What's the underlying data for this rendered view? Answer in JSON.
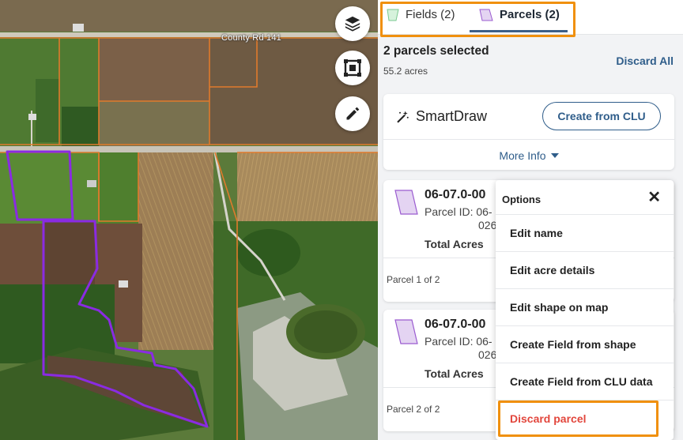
{
  "map": {
    "road_label": "County Rd 141",
    "controls": [
      {
        "name": "layers-button",
        "icon": "layers-icon"
      },
      {
        "name": "select-area-button",
        "icon": "select-frame-icon"
      },
      {
        "name": "draw-button",
        "icon": "pencil-icon"
      }
    ],
    "colors": {
      "parcel_outline": "#8a2be2",
      "field_boundary": "#e07a2c"
    }
  },
  "tabs": [
    {
      "label": "Fields (2)",
      "icon": "field-shape-icon",
      "active": false
    },
    {
      "label": "Parcels (2)",
      "icon": "parcel-shape-icon",
      "active": true
    }
  ],
  "selection": {
    "title": "2 parcels selected",
    "acres": "55.2 acres",
    "discard_all": "Discard All"
  },
  "smartdraw": {
    "title": "SmartDraw",
    "icon": "magic-wand-icon",
    "create_clu": "Create from CLU",
    "more_info": "More Info"
  },
  "parcels": [
    {
      "name": "06-07.0-00",
      "parcel_id": "Parcel ID: 06-",
      "parcel_id_cont": "026",
      "total_acres": "Total Acres",
      "count": "Parcel 1 of 2"
    },
    {
      "name": "06-07.0-00",
      "parcel_id": "Parcel ID: 06-",
      "parcel_id_cont": "026",
      "total_acres": "Total Acres",
      "count": "Parcel 2 of 2"
    }
  ],
  "options_menu": {
    "title": "Options",
    "close": "✕",
    "items": [
      {
        "label": "Edit name"
      },
      {
        "label": "Edit acre details"
      },
      {
        "label": "Edit shape on map"
      },
      {
        "label": "Create Field from shape"
      },
      {
        "label": "Create Field from CLU data"
      },
      {
        "label": "Discard parcel",
        "danger": true
      }
    ]
  },
  "colors": {
    "accent": "#2f5d8a",
    "highlight": "#f0900e",
    "danger": "#e2463c",
    "parcel_fill": "#e4d4f2",
    "field_fill": "#d6f2dc"
  }
}
